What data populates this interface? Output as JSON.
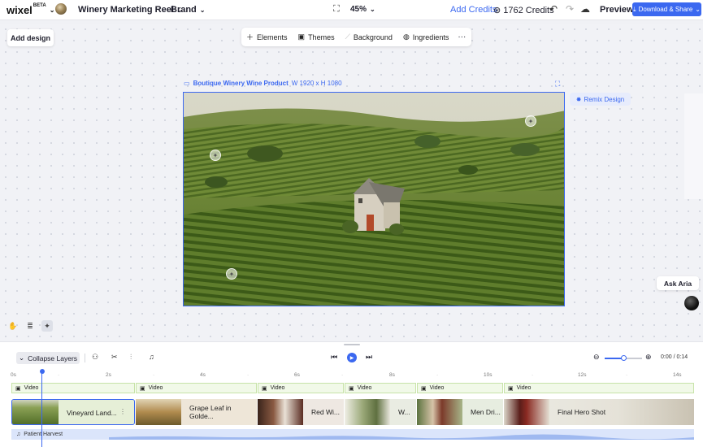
{
  "app": {
    "logo": "wixel",
    "beta": "BETA"
  },
  "header": {
    "project_name": "Winery Marketing Reel",
    "brand_label": "Brand",
    "zoom": "45%",
    "add_credits": "Add Credits",
    "credits": "1762 Credits",
    "preview": "Preview",
    "download": "Download & Share"
  },
  "left": {
    "add_design": "Add design"
  },
  "toolbar": {
    "elements": "Elements",
    "themes": "Themes",
    "background": "Background",
    "ingredients": "Ingredients",
    "more": "···"
  },
  "canvas": {
    "name": "Boutique Winery Wine Product",
    "dimensions": "W 1920 x H 1080",
    "remix": "Remix Design"
  },
  "assistant": {
    "label": "Ask Aria"
  },
  "timeline": {
    "collapse_layers": "Collapse Layers",
    "timecode": "0:00 / 0:14",
    "ruler": [
      "0s",
      "2s",
      "4s",
      "6s",
      "8s",
      "10s",
      "12s",
      "14s"
    ],
    "video_label": "Video",
    "clips": [
      {
        "label": "Vineyard Land..."
      },
      {
        "label": "Grape Leaf in Golde..."
      },
      {
        "label": "Red Wi..."
      },
      {
        "label": "W..."
      },
      {
        "label": "Men Dri..."
      },
      {
        "label": "Final Hero Shot"
      }
    ],
    "audio": "Patient Harvest"
  },
  "colors": {
    "accent": "#3b68f0",
    "video_track": "#f1f9e8",
    "audio_track": "#dbe5fb"
  },
  "icons": {
    "fit": "fit-screen-icon",
    "undo": "undo-icon",
    "redo": "redo-icon",
    "cloud": "cloud-icon",
    "hand": "hand-icon",
    "layers": "layers-icon",
    "magic": "sparkle-icon"
  }
}
